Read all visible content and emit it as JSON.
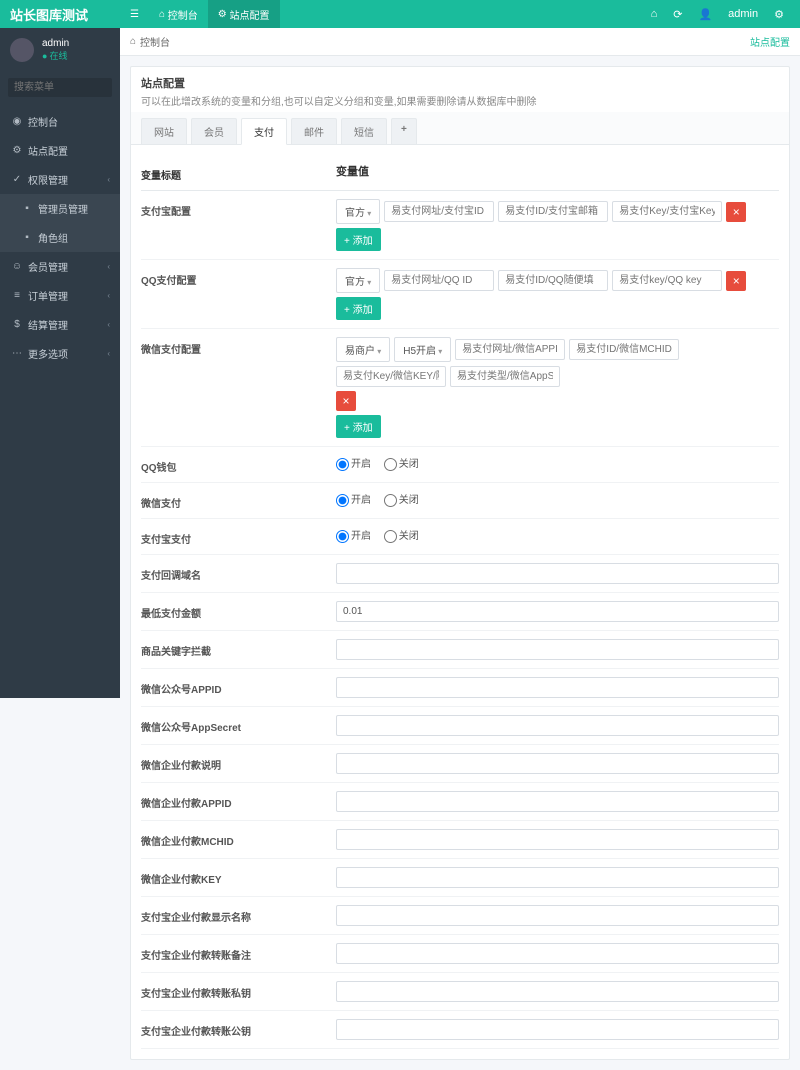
{
  "logo": "站长图库测试",
  "topnav": {
    "dashboard": "控制台",
    "siteconfig": "站点配置"
  },
  "topright": {
    "user": "admin"
  },
  "sidebar": {
    "user": {
      "name": "admin",
      "status": "在线"
    },
    "search_placeholder": "搜索菜单",
    "menu": {
      "dashboard": "控制台",
      "siteconfig": "站点配置",
      "perm": "权限管理",
      "perm_admin": "管理员管理",
      "perm_role": "角色组",
      "member": "会员管理",
      "order": "订单管理",
      "settle": "结算管理",
      "more": "更多选项"
    }
  },
  "breadcrumb": {
    "home": "控制台",
    "right": "站点配置"
  },
  "panel": {
    "title": "站点配置",
    "subtitle": "可以在此增改系统的变量和分组,也可以自定义分组和变量,如果需要删除请从数据库中删除"
  },
  "tabs": [
    "网站",
    "会员",
    "支付",
    "邮件",
    "短信"
  ],
  "headers": {
    "label": "变量标题",
    "value": "变量值"
  },
  "rows": {
    "alipay": {
      "label": "支付宝配置",
      "select": "官方",
      "ph1": "易支付网址/支付宝ID",
      "ph2": "易支付ID/支付宝邮箱",
      "ph3": "易支付Key/支付宝Key",
      "add": "添加"
    },
    "qqpay": {
      "label": "QQ支付配置",
      "select": "官方",
      "ph1": "易支付网址/QQ ID",
      "ph2": "易支付ID/QQ随便填",
      "ph3": "易支付key/QQ key",
      "add": "添加"
    },
    "wxpay": {
      "label": "微信支付配置",
      "select1": "易商户",
      "select2": "H5开启",
      "ph1": "易支付网址/微信APPID/易丰",
      "ph2": "易支付ID/微信MCHID/随便",
      "ph3": "易支付Key/微信KEY/随商户",
      "ph4": "易支付类型/微信AppSecret",
      "add": "添加"
    },
    "radio": {
      "on": "开启",
      "off": "关闭"
    },
    "qq_wallet": "QQ钱包",
    "wx_pay": "微信支付",
    "ali_pay": "支付宝支付",
    "callback_domain": "支付回调域名",
    "min_amount": {
      "label": "最低支付金额",
      "value": "0.01"
    },
    "goods_keyword": "商品关键字拦截",
    "wx_appid": "微信公众号APPID",
    "wx_appsecret": "微信公众号AppSecret",
    "wx_ent_desc": "微信企业付款说明",
    "wx_ent_appid": "微信企业付款APPID",
    "wx_ent_mchid": "微信企业付款MCHID",
    "wx_ent_key": "微信企业付款KEY",
    "ali_ent_name": "支付宝企业付款显示名称",
    "ali_ent_remark": "支付宝企业付款转账备注",
    "ali_ent_prikey": "支付宝企业付款转账私钥",
    "ali_ent_pubkey": "支付宝企业付款转账公钥"
  }
}
